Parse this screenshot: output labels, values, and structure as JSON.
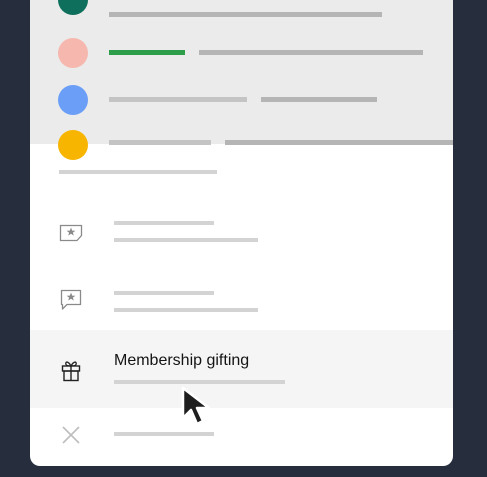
{
  "contacts": [
    {
      "avatar_color": "#0e6f5c"
    },
    {
      "avatar_color": "#f6b8ae"
    },
    {
      "avatar_color": "#6b9ef7"
    },
    {
      "avatar_color": "#f7b500"
    }
  ],
  "menu": {
    "items": [
      {
        "icon": "star-card-icon",
        "label": ""
      },
      {
        "icon": "star-speech-bubble-icon",
        "label": ""
      },
      {
        "icon": "gift-icon",
        "label": "Membership gifting"
      },
      {
        "icon": "close-icon",
        "label": ""
      }
    ]
  },
  "colors": {
    "background": "#262d3d",
    "card": "#ffffff",
    "list_area": "#ebebeb",
    "highlight": "#f5f5f5",
    "accent_line": "#2e9e4b",
    "placeholder_line": "#b5b5b5"
  }
}
